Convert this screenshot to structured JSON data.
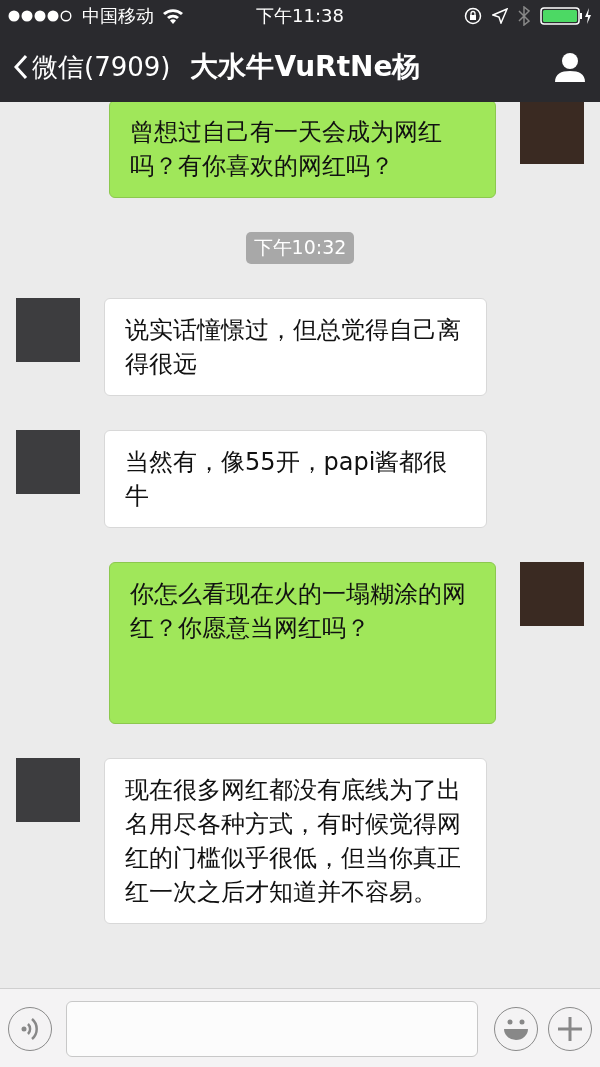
{
  "status_bar": {
    "carrier": "中国移动",
    "time": "下午11:38"
  },
  "nav": {
    "back": "微信(7909)",
    "title": "大水牛VuRtNe杨"
  },
  "messages": [
    {
      "kind": "sent",
      "text": "曾想过自己有一天会成为网红吗？有你喜欢的网红吗？"
    },
    {
      "kind": "time",
      "text": "下午10:32"
    },
    {
      "kind": "received",
      "text": "说实话憧憬过，但总觉得自己离得很远"
    },
    {
      "kind": "received",
      "text": "当然有，像55开，papi酱都很牛"
    },
    {
      "kind": "sent",
      "text": "你怎么看现在火的一塌糊涂的网红？你愿意当网红吗？"
    },
    {
      "kind": "received",
      "text": "现在很多网红都没有底线为了出名用尽各种方式，有时候觉得网红的门槛似乎很低，但当你真正红一次之后才知道并不容易。"
    }
  ]
}
